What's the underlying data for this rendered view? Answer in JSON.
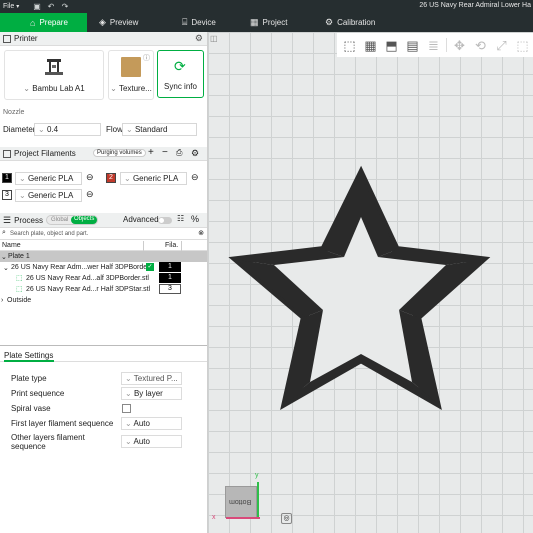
{
  "titlebar": {
    "menu": "File",
    "title": "26 US Navy Rear Admiral Lower Ha"
  },
  "tabs": [
    {
      "label": "Prepare",
      "icon": "prepare-icon"
    },
    {
      "label": "Preview",
      "icon": "preview-icon"
    },
    {
      "label": "Device",
      "icon": "device-icon"
    },
    {
      "label": "Project",
      "icon": "project-icon"
    },
    {
      "label": "Calibration",
      "icon": "calibration-icon"
    }
  ],
  "printer": {
    "section_title": "Printer",
    "printer_name": "Bambu Lab A1",
    "plate_name": "Texture...",
    "sync_label": "Sync info",
    "nozzle_label": "Nozzle",
    "diameter_label": "Diameter",
    "diameter_value": "0.4",
    "flow_label": "Flow",
    "flow_value": "Standard"
  },
  "filaments": {
    "section_title": "Project Filaments",
    "purging_label": "Purging volumes",
    "items": [
      {
        "index": "1",
        "name": "Generic PLA",
        "color": "#000000"
      },
      {
        "index": "2",
        "name": "Generic PLA",
        "color": "#c0392b"
      },
      {
        "index": "3",
        "name": "Generic PLA",
        "color": "#ffffff"
      }
    ]
  },
  "process": {
    "section_title": "Process",
    "global_label": "Global",
    "objects_label": "Objects",
    "advanced_label": "Advanced",
    "search_placeholder": "Search plate, object and part.",
    "col_name": "Name",
    "col_fila": "Fila.",
    "tree": [
      {
        "label": "Plate 1",
        "fila": ""
      },
      {
        "label": "26 US Navy Rear Adm...wer Half 3DPBorder",
        "fila": "1"
      },
      {
        "label": "26 US Navy Rear Ad...alf 3DPBorder.stl",
        "fila": "1"
      },
      {
        "label": "26 US Navy Rear Ad...r Half 3DPStar.stl",
        "fila": "3"
      },
      {
        "label": "Outside",
        "fila": ""
      }
    ]
  },
  "plate_settings": {
    "title": "Plate Settings",
    "rows": [
      {
        "label": "Plate type",
        "value": "Textured P..."
      },
      {
        "label": "Print sequence",
        "value": "By layer"
      },
      {
        "label": "Spiral vase",
        "value": ""
      },
      {
        "label": "First layer filament sequence",
        "value": "Auto"
      },
      {
        "label": "Other layers filament sequence",
        "value": "Auto"
      }
    ]
  },
  "canvas": {
    "plate_label": "Bottom",
    "axis_x": "x",
    "axis_y": "y"
  }
}
